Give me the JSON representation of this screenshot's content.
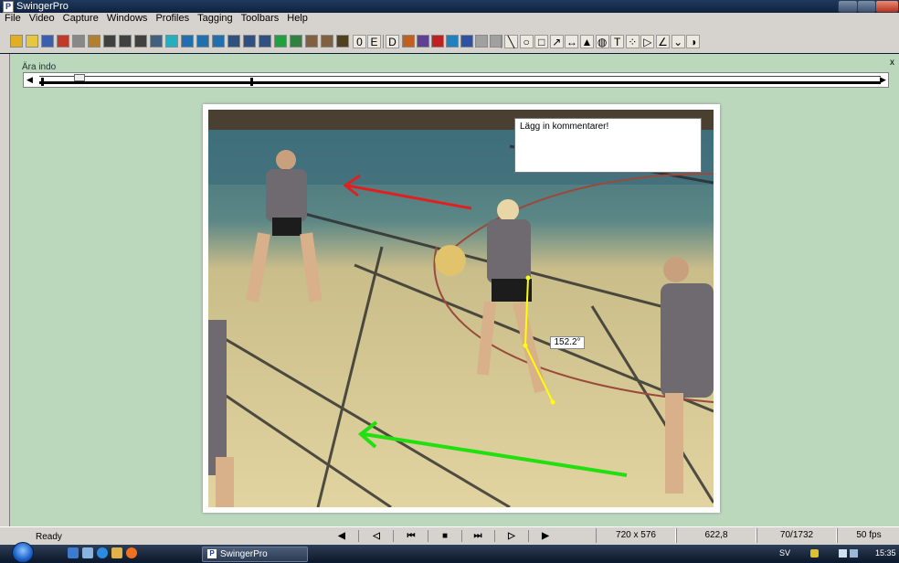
{
  "window": {
    "title": "SwingerPro",
    "app_icon_letter": "P"
  },
  "menu": [
    "File",
    "Video",
    "Capture",
    "Windows",
    "Profiles",
    "Tagging",
    "Toolbars",
    "Help"
  ],
  "toolbar": {
    "colors": [
      "#e0b020",
      "#e6c840",
      "#3a5fb0",
      "#c0392b",
      "#888888",
      "#b08030",
      "#404040",
      "#404040",
      "#404040",
      "#406080",
      "#20b0c0",
      "#2070b0",
      "#2070b0",
      "#2070b0",
      "#305080",
      "#305080",
      "#305080",
      "#20a040",
      "#308040",
      "#806040",
      "#806040",
      "#504020"
    ],
    "glyphs": [
      "0",
      "E",
      "D"
    ],
    "colors2": [
      "#c06020",
      "#604090",
      "#c02020",
      "#2080c0",
      "#3050a0",
      "#a0a0a0",
      "#a0a0a0"
    ],
    "draw_glyphs": [
      "╲",
      "○",
      "□",
      "↗",
      "↔",
      "▲",
      "◍",
      "T",
      "⁘",
      "▷",
      "∠",
      "⌄",
      "◑"
    ]
  },
  "panel": {
    "label": "Ära indo",
    "close": "x"
  },
  "timeline": {
    "left_arrow": "◀",
    "right_arrow": "▶",
    "position": 0.003
  },
  "overlay": {
    "comment": "Lägg in kommentarer!",
    "angle": "152.2°"
  },
  "statusbar": {
    "ready": "Ready",
    "controls": [
      "◀",
      "◁",
      "⏮",
      "■",
      "⏭",
      "▷",
      "▶"
    ],
    "resolution": "720 x 576",
    "time": "622,8",
    "frame": "70/1732",
    "fps": "50 fps"
  },
  "taskbar": {
    "task_label": "SwingerPro",
    "lang": "SV",
    "clock": "15:35"
  }
}
